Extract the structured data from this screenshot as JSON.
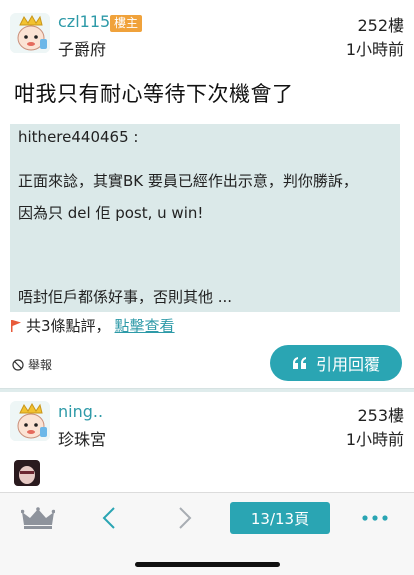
{
  "post1": {
    "username": "czl115",
    "op_badge": "樓主",
    "rank": "子爵府",
    "floor": "252樓",
    "time": "1小時前",
    "headline": "咁我只有耐心等待下次機會了",
    "quote_lines": [
      "hithere440465 :",
      "正面來諗，其實BK 要員已經作出示意，判你勝訴，",
      "因為只 del 佢 post, u win!",
      "唔封佢戶都係好事，否則其他 ..."
    ],
    "comments_prefix": "共3條點評，",
    "comments_link": "點擊查看",
    "report_label": "舉報",
    "reply_label": "引用回覆"
  },
  "post2": {
    "username": "ning..",
    "rank": "珍珠宮",
    "floor": "253樓",
    "time": "1小時前"
  },
  "bottom_bar": {
    "page_label": "13/13頁",
    "icons": [
      "crown-icon",
      "chevron-left-icon",
      "chevron-right-icon",
      "more-icon"
    ]
  },
  "colors": {
    "accent": "#2aa5b3",
    "link": "#2e9aa8",
    "badge": "#f0a23b",
    "quote_bg": "#dbe9e9",
    "page_bg": "#dfecec"
  }
}
